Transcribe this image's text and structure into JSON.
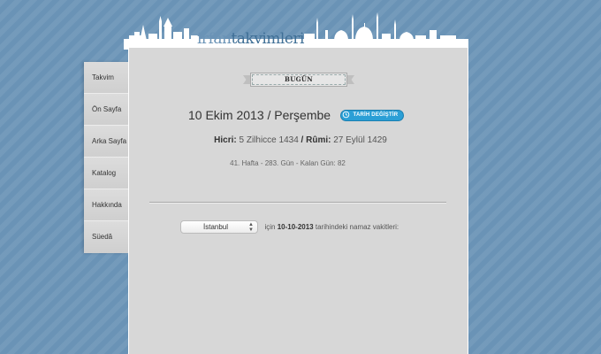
{
  "site": {
    "logo_part1": "irfan",
    "logo_part2": "takvimleri"
  },
  "nav": {
    "items": [
      {
        "label": "Takvim"
      },
      {
        "label": "Ön Sayfa"
      },
      {
        "label": "Arka Sayfa"
      },
      {
        "label": "Katalog"
      },
      {
        "label": "Hakkında"
      },
      {
        "label": "Süedâ"
      }
    ]
  },
  "today": {
    "ribbon_label": "BUGÜN",
    "date_text": "10 Ekim 2013 / Perşembe",
    "change_date_label": "TARİH DEĞİŞTİR",
    "hijri_label": "Hicri:",
    "hijri_value": "5 Zilhicce 1434",
    "sep": " / ",
    "rumi_label": "Rûmi:",
    "rumi_value": "27 Eylül 1429",
    "week_info": "41. Hafta - 283. Gün - Kalan Gün: 82"
  },
  "prayer": {
    "city_selected": "İstanbul",
    "text_pre": "için",
    "date": "10-10-2013",
    "text_post": "tarihindeki namaz vakitleri:"
  },
  "colors": {
    "background": "#6a93b6",
    "panel": "#d7d7d7",
    "accent_button": "#2b9fd6"
  }
}
